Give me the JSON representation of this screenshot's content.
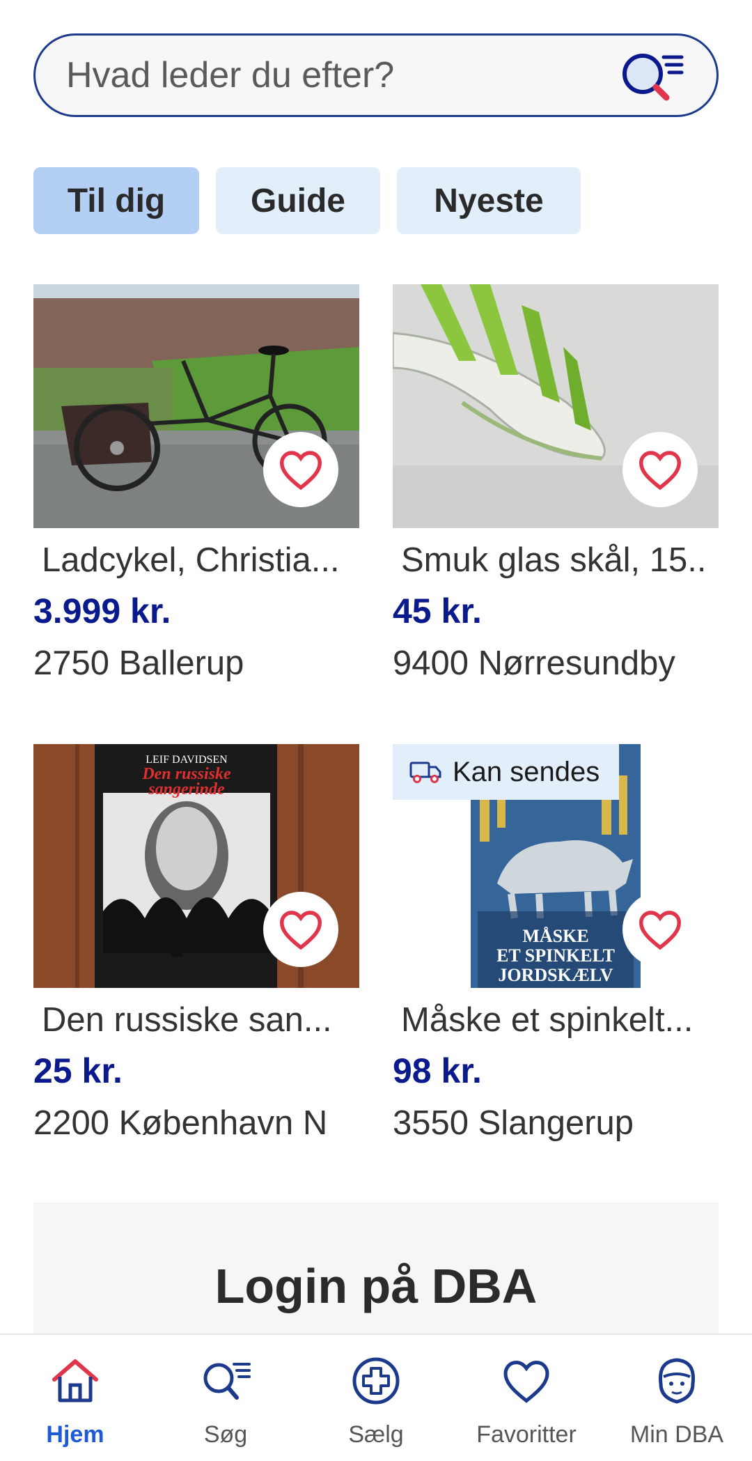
{
  "search": {
    "placeholder": "Hvad leder du efter?"
  },
  "tabs": [
    {
      "label": "Til dig",
      "active": true
    },
    {
      "label": "Guide",
      "active": false
    },
    {
      "label": "Nyeste",
      "active": false
    }
  ],
  "listings": [
    {
      "title": "Ladcykel, Christia...",
      "price": "3.999 kr.",
      "location": "2750 Ballerup"
    },
    {
      "title": "Smuk glas skål, 15..",
      "price": "45 kr.",
      "location": "9400 Nørresundby"
    },
    {
      "title": "Den russiske san...",
      "price": "25 kr.",
      "location": "2200 København N"
    },
    {
      "title": "Måske et spinkelt...",
      "price": "98 kr.",
      "location": "3550 Slangerup",
      "badge": "Kan sendes"
    }
  ],
  "book1": {
    "author": "LEIF DAVIDSEN",
    "title_line1": "Den russiske",
    "title_line2": "sangerinde"
  },
  "book2": {
    "line1": "MÅSKE",
    "line2": "ET SPINKELT",
    "line3": "JORDSKÆLV"
  },
  "login": {
    "title": "Login på DBA"
  },
  "nav": [
    {
      "label": "Hjem",
      "icon": "home-icon",
      "active": true
    },
    {
      "label": "Søg",
      "icon": "search-icon",
      "active": false
    },
    {
      "label": "Sælg",
      "icon": "plus-circle-icon",
      "active": false
    },
    {
      "label": "Favoritter",
      "icon": "heart-icon",
      "active": false
    },
    {
      "label": "Min DBA",
      "icon": "user-icon",
      "active": false
    }
  ],
  "colors": {
    "brand": "#0a1a8c",
    "accent": "#2059d6",
    "heart": "#e0354a",
    "tab_active": "#b3cff4",
    "tab_inactive": "#e2eefa"
  }
}
